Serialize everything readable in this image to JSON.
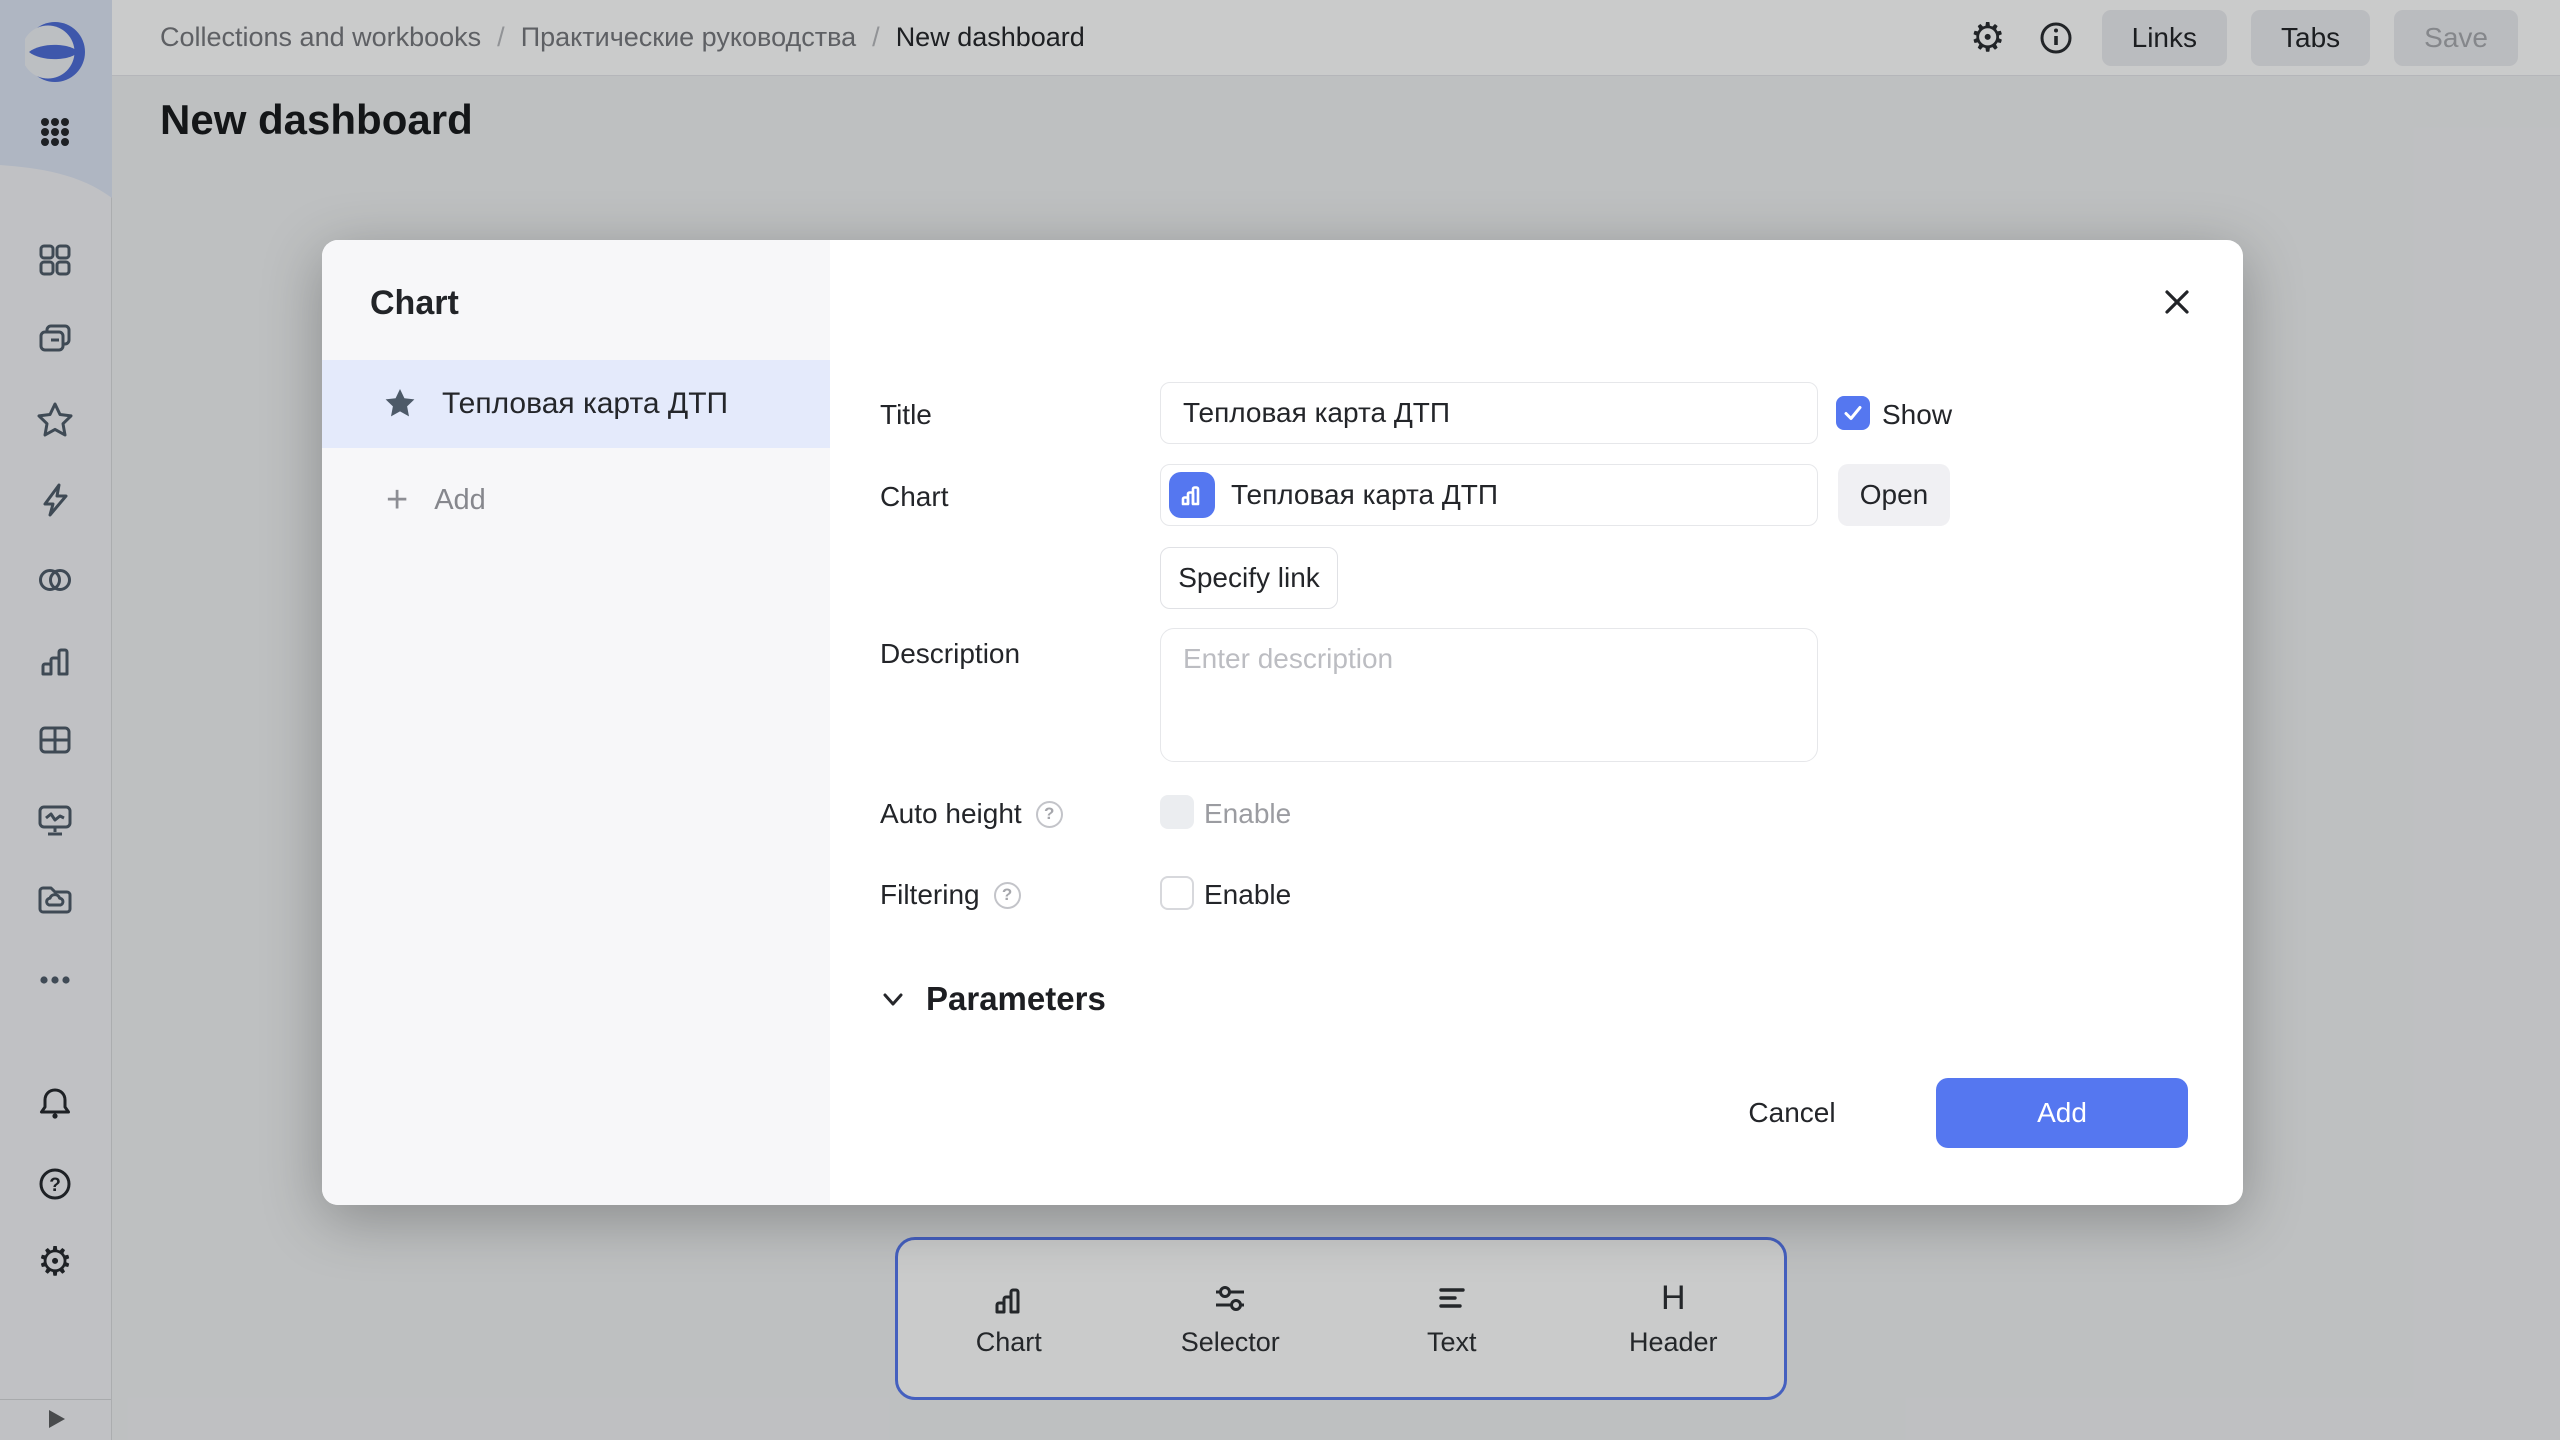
{
  "colors": {
    "accent": "#5577F0",
    "selected_row": "#E4EAFB",
    "logo_blue": "#4C6BD6"
  },
  "topbar": {
    "breadcrumbs": [
      "Collections and workbooks",
      "Практические руководства",
      "New dashboard"
    ],
    "separator": "/",
    "icons": [
      "gear-icon",
      "info-icon"
    ],
    "buttons": {
      "links": "Links",
      "tabs": "Tabs",
      "save": "Save"
    }
  },
  "sidebar": {
    "icons": [
      "apps-grid-icon",
      "tiles-icon",
      "collections-icon",
      "favorites-star-icon",
      "connections-lightning-icon",
      "datasets-circles-icon",
      "charts-bars-icon",
      "tables-icon",
      "dashboards-monitor-icon",
      "storage-folder-icon",
      "more-icon"
    ],
    "footer_icons": [
      "bell-icon",
      "help-icon",
      "settings-gear-icon",
      "expand-arrow-icon"
    ]
  },
  "page": {
    "title": "New dashboard"
  },
  "modal": {
    "title": "Chart",
    "list": {
      "selected_item": "Тепловая карта ДТП",
      "add_label": "Add"
    },
    "form": {
      "title_label": "Title",
      "title_value": "Тепловая карта ДТП",
      "show_label": "Show",
      "chart_label": "Chart",
      "chart_value": "Тепловая карта ДТП",
      "open_label": "Open",
      "specify_link_label": "Specify link",
      "description_label": "Description",
      "description_placeholder": "Enter description",
      "auto_height_label": "Auto height",
      "auto_height_enable_label": "Enable",
      "filtering_label": "Filtering",
      "filtering_enable_label": "Enable",
      "parameters_label": "Parameters"
    },
    "footer": {
      "cancel": "Cancel",
      "add": "Add"
    }
  },
  "widgets": {
    "items": [
      {
        "icon": "chart-bars-icon",
        "label": "Chart"
      },
      {
        "icon": "selector-sliders-icon",
        "label": "Selector"
      },
      {
        "icon": "text-lines-icon",
        "label": "Text"
      },
      {
        "icon": "header-h-icon",
        "label": "Header"
      }
    ]
  },
  "glyphs": {
    "gear": "⚙",
    "plus": "+",
    "help": "?",
    "header": "H"
  }
}
